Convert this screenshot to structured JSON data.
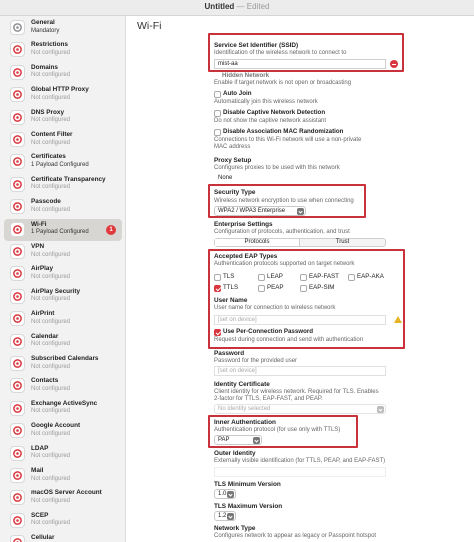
{
  "window": {
    "title": "Untitled",
    "state": "Edited"
  },
  "sidebar": {
    "items": [
      {
        "name": "General",
        "sub": "Mandatory",
        "icon": "gear-icon"
      },
      {
        "name": "Restrictions",
        "sub": "Not configured",
        "icon": "restrictions-icon"
      },
      {
        "name": "Domains",
        "sub": "Not configured",
        "icon": "domains-icon"
      },
      {
        "name": "Global HTTP Proxy",
        "sub": "Not configured",
        "icon": "globe-icon"
      },
      {
        "name": "DNS Proxy",
        "sub": "Not configured",
        "icon": "dns-icon"
      },
      {
        "name": "Content Filter",
        "sub": "Not configured",
        "icon": "filter-icon"
      },
      {
        "name": "Certificates",
        "sub": "1 Payload Configured",
        "icon": "certificate-icon"
      },
      {
        "name": "Certificate Transparency",
        "sub": "Not configured",
        "icon": "certificate-transparency-icon"
      },
      {
        "name": "Passcode",
        "sub": "Not configured",
        "icon": "passcode-icon"
      },
      {
        "name": "Wi-Fi",
        "sub": "1 Payload Configured",
        "icon": "wifi-icon",
        "badge": "1"
      },
      {
        "name": "VPN",
        "sub": "Not configured",
        "icon": "vpn-icon"
      },
      {
        "name": "AirPlay",
        "sub": "Not configured",
        "icon": "airplay-icon"
      },
      {
        "name": "AirPlay Security",
        "sub": "Not configured",
        "icon": "airplay-security-icon"
      },
      {
        "name": "AirPrint",
        "sub": "Not configured",
        "icon": "airprint-icon"
      },
      {
        "name": "Calendar",
        "sub": "Not configured",
        "icon": "calendar-icon"
      },
      {
        "name": "Subscribed Calendars",
        "sub": "Not configured",
        "icon": "subscribed-calendar-icon"
      },
      {
        "name": "Contacts",
        "sub": "Not configured",
        "icon": "contacts-icon"
      },
      {
        "name": "Exchange ActiveSync",
        "sub": "Not configured",
        "icon": "exchange-icon"
      },
      {
        "name": "Google Account",
        "sub": "Not configured",
        "icon": "google-icon"
      },
      {
        "name": "LDAP",
        "sub": "Not configured",
        "icon": "ldap-icon"
      },
      {
        "name": "Mail",
        "sub": "Not configured",
        "icon": "mail-icon"
      },
      {
        "name": "macOS Server Account",
        "sub": "Not configured",
        "icon": "server-icon"
      },
      {
        "name": "SCEP",
        "sub": "Not configured",
        "icon": "scep-icon"
      },
      {
        "name": "Cellular",
        "sub": "",
        "icon": "cellular-icon"
      }
    ]
  },
  "main": {
    "title": "Wi-Fi",
    "ssid": {
      "title": "Service Set Identifier (SSID)",
      "desc": "Identification of the wireless network to connect to",
      "value": "mist-aa"
    },
    "hidden": {
      "label": "Hidden Network",
      "desc": "Enable if target network is not open or broadcasting"
    },
    "auto_join": {
      "label": "Auto Join",
      "desc": "Automatically join this wireless network"
    },
    "captive": {
      "label": "Disable Captive Network Detection",
      "desc": "Do not show the captive network assistant"
    },
    "mac_random": {
      "label": "Disable Association MAC Randomization",
      "desc1": "Connections to this Wi-Fi network will use a non-private",
      "desc2": "MAC address"
    },
    "proxy": {
      "title": "Proxy Setup",
      "desc": "Configures proxies to be used with this network",
      "value": "None"
    },
    "security": {
      "title": "Security Type",
      "desc": "Wireless network encryption to use when connecting",
      "value": "WPA2 / WPA3 Enterprise"
    },
    "enterprise": {
      "title": "Enterprise Settings",
      "desc": "Configuration of protocols, authentication, and trust",
      "tab_protocols": "Protocols",
      "tab_trust": "Trust"
    },
    "eap": {
      "title": "Accepted EAP Types",
      "desc": "Authentication protocols supported on target network",
      "types": [
        {
          "label": "TLS",
          "checked": false
        },
        {
          "label": "LEAP",
          "checked": false
        },
        {
          "label": "EAP-FAST",
          "checked": false
        },
        {
          "label": "EAP-AKA",
          "checked": false
        },
        {
          "label": "TTLS",
          "checked": true
        },
        {
          "label": "PEAP",
          "checked": false
        },
        {
          "label": "EAP-SIM",
          "checked": false
        }
      ]
    },
    "username": {
      "title": "User Name",
      "desc": "User name for connection to wireless network",
      "placeholder": "[set on device]"
    },
    "per_conn_pw": {
      "label": "Use Per-Connection Password",
      "desc": "Request during connection and send with authentication"
    },
    "password": {
      "title": "Password",
      "desc": "Password for the provided user",
      "placeholder": "[set on device]"
    },
    "identity_cert": {
      "title": "Identity Certificate",
      "desc1": "Client identity for wireless network. Required for TLS. Enables",
      "desc2": "2-factor for TTLS, EAP-FAST, and PEAP.",
      "value": "No identity selected"
    },
    "inner_auth": {
      "title": "Inner Authentication",
      "desc": "Authentication protocol (for use only with TTLS)",
      "value": "PAP"
    },
    "outer_identity": {
      "title": "Outer Identity",
      "desc": "Externally visible identification (for TTLS, PEAP, and EAP-FAST)"
    },
    "tls_min": {
      "title": "TLS Minimum Version",
      "value": "1.0"
    },
    "tls_max": {
      "title": "TLS Maximum Version",
      "value": "1.2"
    },
    "network_type": {
      "title": "Network Type",
      "desc": "Configures network to appear as legacy or Passpoint hotspot"
    }
  }
}
